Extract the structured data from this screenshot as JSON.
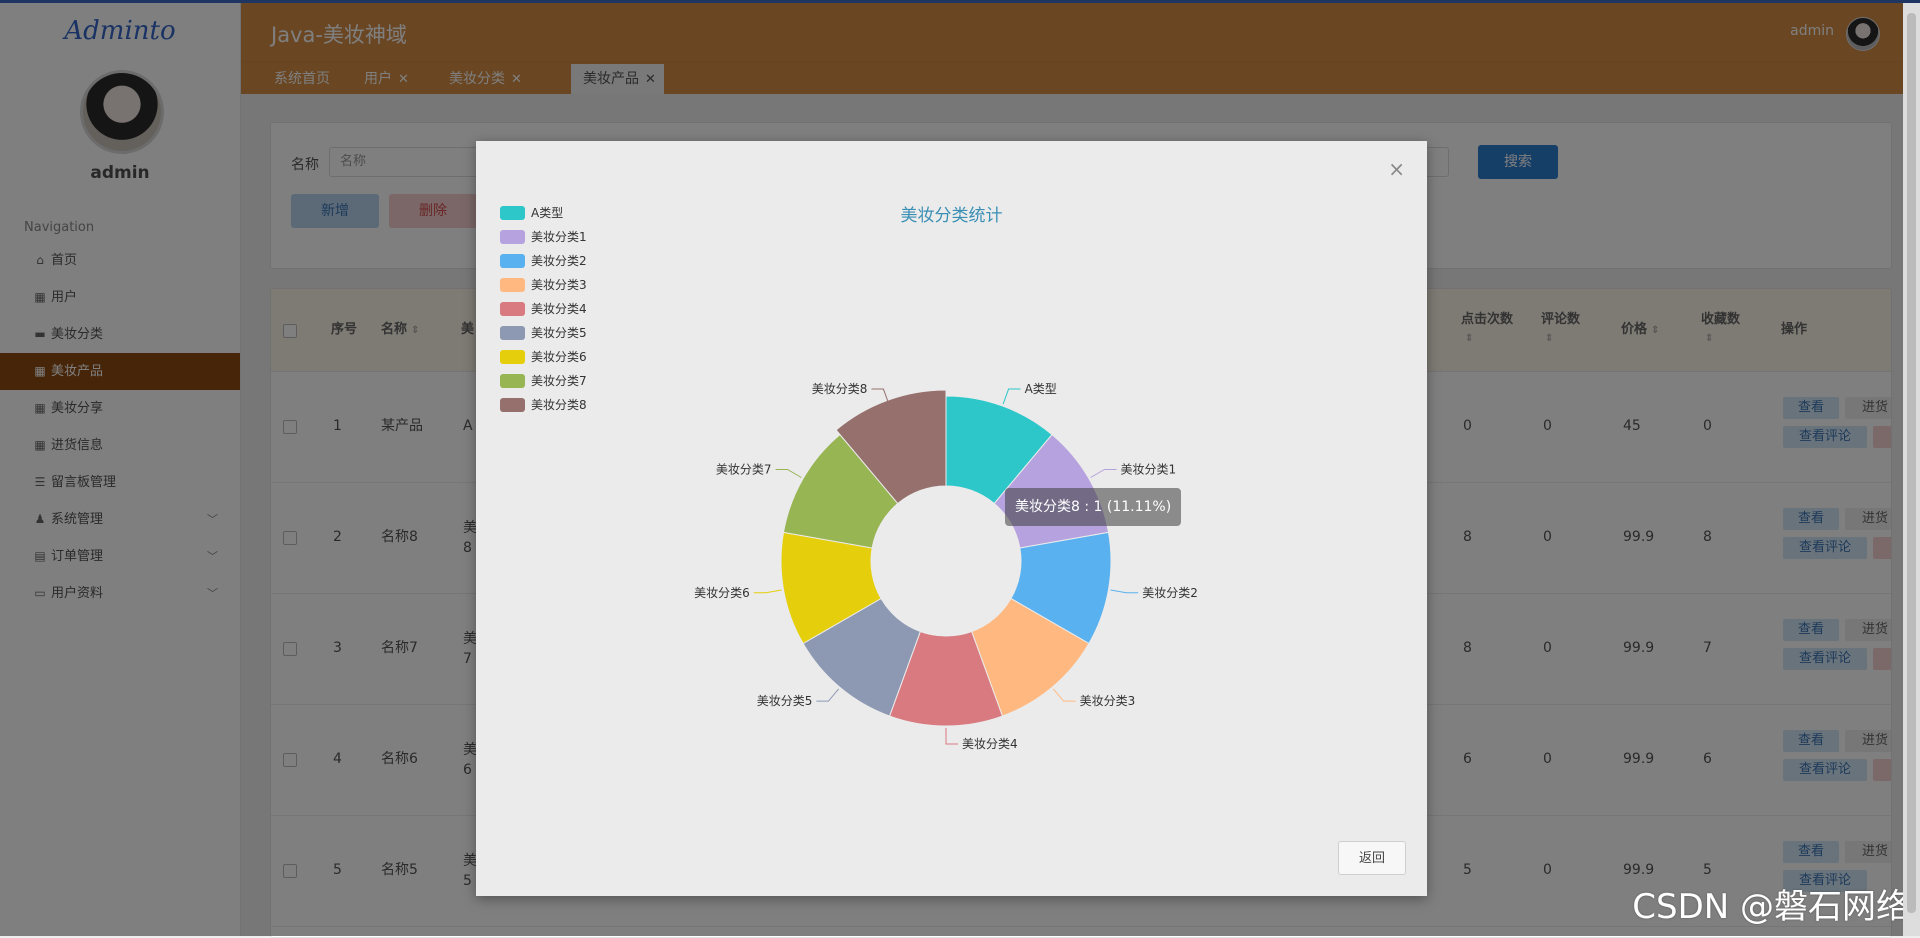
{
  "app": {
    "logo": "Adminto",
    "title": "Java-美妆神域",
    "user": "admin"
  },
  "sidebar": {
    "username": "admin",
    "nav_heading": "Navigation",
    "items": [
      {
        "label": "首页",
        "icon": "home-icon"
      },
      {
        "label": "用户",
        "icon": "grid-icon"
      },
      {
        "label": "美妆分类",
        "icon": "folder-icon"
      },
      {
        "label": "美妆产品",
        "icon": "grid-icon",
        "active": true
      },
      {
        "label": "美妆分享",
        "icon": "grid-icon"
      },
      {
        "label": "进货信息",
        "icon": "grid-icon"
      },
      {
        "label": "留言板管理",
        "icon": "sliders-icon"
      },
      {
        "label": "系统管理",
        "icon": "user-icon",
        "expandable": true
      },
      {
        "label": "订单管理",
        "icon": "clipboard-icon",
        "expandable": true
      },
      {
        "label": "用户资料",
        "icon": "card-icon",
        "expandable": true
      }
    ]
  },
  "tabs": [
    {
      "label": "系统首页",
      "closable": false
    },
    {
      "label": "用户",
      "closable": true
    },
    {
      "label": "美妆分类",
      "closable": true
    },
    {
      "label": "美妆产品",
      "closable": true,
      "active": true
    }
  ],
  "search": {
    "label": "名称",
    "placeholder": "名称",
    "button": "搜索",
    "add": "新增",
    "delete": "删除"
  },
  "table": {
    "headers": {
      "index": "序号",
      "name": "名称",
      "clicks": "点击次数",
      "comments": "评论数",
      "price": "价格",
      "favorites": "收藏数",
      "actions": "操作",
      "col3_fragment": "美"
    },
    "rows": [
      {
        "index": "1",
        "name": "某产品",
        "cat": "A",
        "clicks": "0",
        "comments": "0",
        "price": "45",
        "favorites": "0"
      },
      {
        "index": "2",
        "name": "名称8",
        "cat": "美\n8",
        "clicks": "8",
        "comments": "0",
        "price": "99.9",
        "favorites": "8"
      },
      {
        "index": "3",
        "name": "名称7",
        "cat": "美\n7",
        "clicks": "8",
        "comments": "0",
        "price": "99.9",
        "favorites": "7"
      },
      {
        "index": "4",
        "name": "名称6",
        "cat": "美\n6",
        "clicks": "6",
        "comments": "0",
        "price": "99.9",
        "favorites": "6"
      },
      {
        "index": "5",
        "name": "名称5",
        "cat": "美\n5",
        "clicks": "5",
        "comments": "0",
        "price": "99.9",
        "favorites": "5"
      }
    ],
    "actions": {
      "view": "查看",
      "stock": "进货",
      "review": "查看评论"
    }
  },
  "modal": {
    "close": "×",
    "back": "返回",
    "tooltip": "美妆分类8 : 1 (11.11%)"
  },
  "chart_data": {
    "type": "pie",
    "title": "美妆分类统计",
    "donut": true,
    "legend_position": "top-left",
    "categories": [
      "A类型",
      "美妆分类1",
      "美妆分类2",
      "美妆分类3",
      "美妆分类4",
      "美妆分类5",
      "美妆分类6",
      "美妆分类7",
      "美妆分类8"
    ],
    "values": [
      1,
      1,
      1,
      1,
      1,
      1,
      1,
      1,
      1
    ],
    "colors": [
      "#2ec7c9",
      "#b6a2de",
      "#5ab1ef",
      "#ffb980",
      "#d87a80",
      "#8d98b3",
      "#e5cf0d",
      "#97b552",
      "#95706d"
    ],
    "highlighted": "美妆分类8"
  },
  "watermark": "CSDN @磐石网络"
}
